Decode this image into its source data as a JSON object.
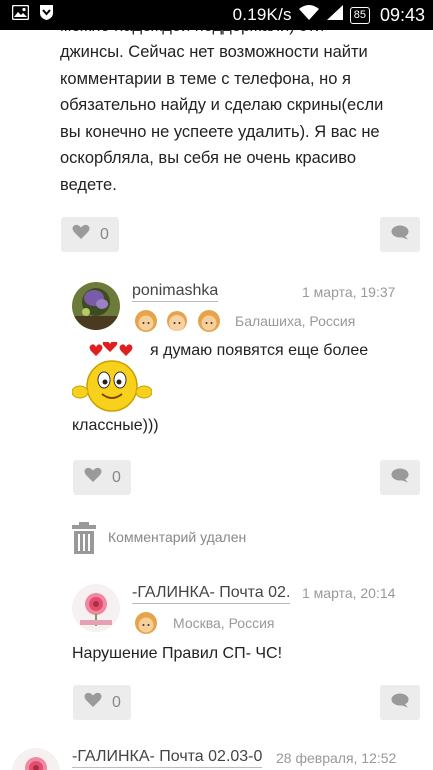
{
  "status_bar": {
    "net_speed": "0.19K/s",
    "battery": "85",
    "time": "09:43"
  },
  "top_comment": {
    "partial_line": "можно надеждой поддержали) эти",
    "text_lines": [
      "джинсы. Сейчас нет возможности найти",
      "комментарии в теме с телефона, но я",
      "обязательно найду и сделаю скрины(если",
      "вы конечно не успеете удалить). Я вас не",
      "оскорбляла, вы себя не очень красиво",
      "ведете."
    ],
    "likes": "0"
  },
  "comments": [
    {
      "username": "ponimashka",
      "date": "1 марта, 19:37",
      "location": "Балашиха, Россия",
      "text_line1": "я думаю появятся еще более",
      "text_line2": "классные)))",
      "likes": "0"
    },
    {
      "deleted_label": "Комментарий удален"
    },
    {
      "username": "-ГАЛИНКА- Почта 02.",
      "date": "1 марта, 20:14",
      "location": "Москва, Россия",
      "text": "Нарушение  Правил СП- ЧС!",
      "likes": "0"
    },
    {
      "username": "-ГАЛИНКА- Почта 02.03-0",
      "date": "28 февраля, 12:52"
    }
  ],
  "colors": {
    "button_bg": "#ececec",
    "icon_gray": "#9a9a9a",
    "text": "#222222",
    "meta_gray": "#999999"
  }
}
